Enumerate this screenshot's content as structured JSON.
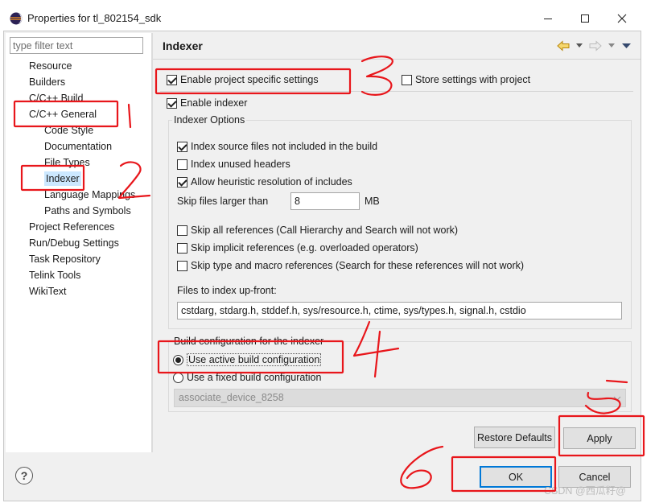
{
  "window": {
    "title": "Properties for tl_802154_sdk",
    "icons": [
      "eclipse-icon",
      "minimize-icon",
      "maximize-icon",
      "close-icon"
    ]
  },
  "filter": {
    "placeholder": "type filter text"
  },
  "nav": {
    "items": [
      {
        "label": "Resource",
        "level": 0
      },
      {
        "label": "Builders",
        "level": 0
      },
      {
        "label": "C/C++ Build",
        "level": 0
      },
      {
        "label": "C/C++ General",
        "level": 0
      },
      {
        "label": "Code Style",
        "level": 1
      },
      {
        "label": "Documentation",
        "level": 1
      },
      {
        "label": "File Types",
        "level": 1
      },
      {
        "label": "Indexer",
        "level": 1,
        "selected": true
      },
      {
        "label": "Language Mappings",
        "level": 1
      },
      {
        "label": "Paths and Symbols",
        "level": 1
      },
      {
        "label": "Project References",
        "level": 0
      },
      {
        "label": "Run/Debug Settings",
        "level": 0
      },
      {
        "label": "Task Repository",
        "level": 0
      },
      {
        "label": "Telink Tools",
        "level": 0
      },
      {
        "label": "WikiText",
        "level": 0
      }
    ]
  },
  "page": {
    "title": "Indexer",
    "header_icons": [
      "back-arrow-icon",
      "dropdown-icon",
      "forward-arrow-icon",
      "dropdown-icon",
      "view-menu-icon"
    ],
    "enable_project_specific": {
      "label": "Enable project specific settings",
      "checked": true
    },
    "store_with_project": {
      "label": "Store settings with project",
      "checked": false
    },
    "enable_indexer": {
      "label": "Enable indexer",
      "checked": true
    },
    "indexer_options": {
      "legend": "Indexer Options",
      "options_a": [
        {
          "label": "Index source files not included in the build",
          "checked": true
        },
        {
          "label": "Index unused headers",
          "checked": false
        },
        {
          "label": "Allow heuristic resolution of includes",
          "checked": true
        }
      ],
      "skip_larger": {
        "label": "Skip files larger than",
        "value": "8",
        "unit": "MB"
      },
      "options_b": [
        {
          "label": "Skip all references (Call Hierarchy and Search will not work)",
          "checked": false
        },
        {
          "label": "Skip implicit references (e.g. overloaded operators)",
          "checked": false
        },
        {
          "label": "Skip type and macro references (Search for these references will not work)",
          "checked": false
        }
      ],
      "upfront": {
        "label": "Files to index up-front:",
        "value": "cstdarg, stdarg.h, stddef.h, sys/resource.h, ctime, sys/types.h, signal.h, cstdio"
      }
    },
    "build_config": {
      "legend": "Build configuration for the indexer",
      "use_active": {
        "label": "Use active build configuration",
        "selected": true
      },
      "use_fixed": {
        "label": "Use a fixed build configuration",
        "selected": false
      },
      "fixed_value": "associate_device_8258"
    }
  },
  "buttons": {
    "restore_defaults": "Restore Defaults",
    "apply": "Apply",
    "ok": "OK",
    "cancel": "Cancel",
    "help": "?"
  },
  "watermark": "CSDN @西瓜籽@",
  "annotation_color": "#e8161b"
}
